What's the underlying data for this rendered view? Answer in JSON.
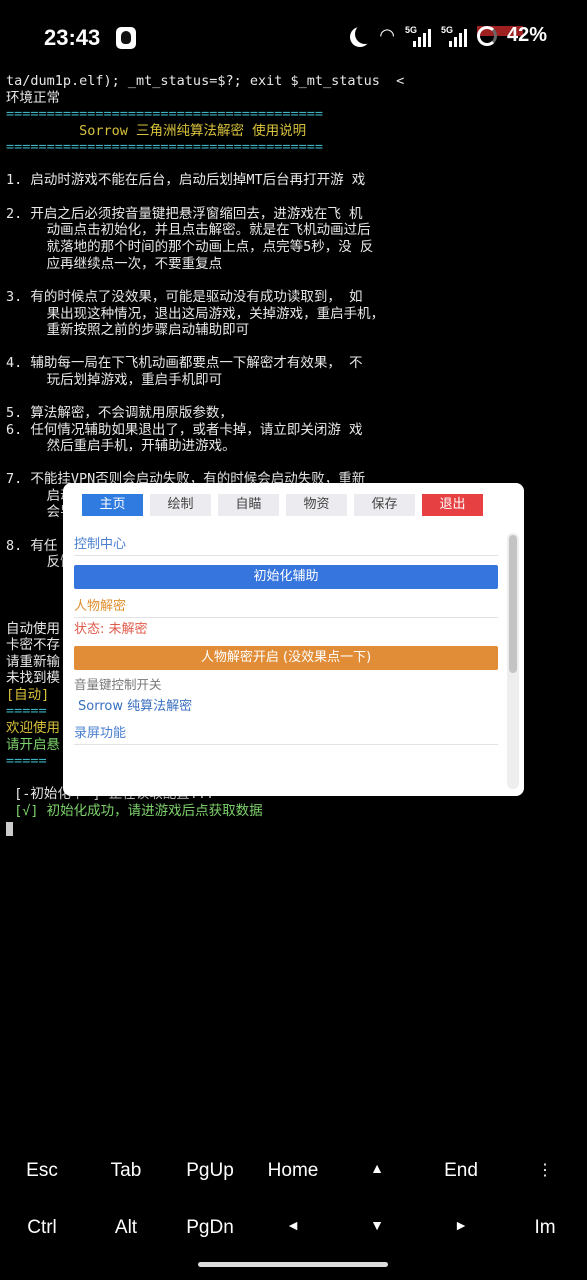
{
  "status_bar": {
    "time": "23:43",
    "battery": "42%",
    "icons": [
      "qq-icon",
      "moon-icon",
      "wifi-icon",
      "signal-5g-icon",
      "signal-5g-icon",
      "battery-icon"
    ]
  },
  "terminal": {
    "lines": [
      {
        "text": "ta/dum1p.elf); _mt_status=$?; exit $_mt_status  <",
        "cls": ""
      },
      {
        "text": "环境正常",
        "cls": ""
      },
      {
        "text": "=======================================",
        "cls": "cyan"
      },
      {
        "text": "         Sorrow 三角洲纯算法解密 使用说明",
        "cls": "yellow"
      },
      {
        "text": "=======================================",
        "cls": "cyan"
      },
      {
        "text": "1. 启动时游戏不能在后台，启动后划掉MT后台再打开游 戏",
        "cls": ""
      },
      {
        "text": "2. 开启之后必须按音量键把悬浮窗缩回去，进游戏在飞 机",
        "cls": ""
      },
      {
        "text": "     动画点击初始化，并且点击解密。就是在飞机动画过后",
        "cls": ""
      },
      {
        "text": "     就落地的那个时间的那个动画上点，点完等5秒，没 反",
        "cls": ""
      },
      {
        "text": "     应再继续点一次，不要重复点",
        "cls": ""
      },
      {
        "text": "3. 有的时候点了没效果，可能是驱动没有成功读取到， 如",
        "cls": ""
      },
      {
        "text": "     果出现这种情况，退出这局游戏，关掉游戏，重启手机，",
        "cls": ""
      },
      {
        "text": "     重新按照之前的步骤启动辅助即可",
        "cls": ""
      },
      {
        "text": "4. 辅助每一局在下飞机动画都要点一下解密才有效果， 不",
        "cls": ""
      },
      {
        "text": "     玩后划掉游戏，重启手机即可",
        "cls": ""
      },
      {
        "text": "5. 算法解密，不会调就用原版参数，",
        "cls": ""
      },
      {
        "text": "6. 任何情况辅助如果退出了，或者卡掉，请立即关闭游 戏",
        "cls": ""
      },
      {
        "text": "     然后重启手机，开辅助进游戏。",
        "cls": ""
      },
      {
        "text": "7. 不能挂VPN否则会启动失败，有的时候会启动失败，重新",
        "cls": ""
      },
      {
        "text": "     启动",
        "cls": ""
      },
      {
        "text": "     会导",
        "cls": ""
      },
      {
        "text": "8. 有任",
        "cls": ""
      },
      {
        "text": "     反馈",
        "cls": ""
      },
      {
        "text": "自动使用",
        "cls": ""
      },
      {
        "text": "卡密不存",
        "cls": ""
      },
      {
        "text": "请重新输",
        "cls": ""
      },
      {
        "text": "未找到模",
        "cls": ""
      },
      {
        "text": "[自动]",
        "cls": "yellow"
      },
      {
        "text": "=====",
        "cls": "cyan"
      },
      {
        "text": "欢迎使用",
        "cls": "yellow"
      },
      {
        "text": "请开启悬",
        "cls": "green"
      },
      {
        "text": "=====",
        "cls": "cyan"
      },
      {
        "text": " [-初始化中-] 正在读取配置...",
        "cls": ""
      },
      {
        "text": " [√] 初始化成功，请进游戏后点获取数据",
        "cls": "green"
      }
    ]
  },
  "panel": {
    "tabs": [
      {
        "label": "主页",
        "state": "active"
      },
      {
        "label": "绘制",
        "state": ""
      },
      {
        "label": "自瞄",
        "state": ""
      },
      {
        "label": "物资",
        "state": ""
      },
      {
        "label": "保存",
        "state": ""
      },
      {
        "label": "退出",
        "state": "exit"
      }
    ],
    "control_center": "控制中心",
    "init_button": "初始化辅助",
    "char_decrypt_section": "人物解密",
    "status_text": "状态: 未解密",
    "decrypt_button": "人物解密开启 (没效果点一下)",
    "volume_label": "音量键控制开关",
    "sorrow_label": "Sorrow 纯算法解密",
    "record_section": "录屏功能"
  },
  "keys": {
    "row1": [
      "Esc",
      "Tab",
      "PgUp",
      "Home",
      "▲",
      "End",
      "⋮"
    ],
    "row2": [
      "Ctrl",
      "Alt",
      "PgDn",
      "◄",
      "▼",
      "►",
      "Im"
    ]
  },
  "colors": {
    "accent_blue": "#2f7be0",
    "exit_red": "#e64043",
    "decrypt_orange": "#e18d37",
    "terminal_cyan": "#3bb3c3",
    "terminal_yellow": "#d8c23c",
    "terminal_green": "#7dd36b"
  }
}
